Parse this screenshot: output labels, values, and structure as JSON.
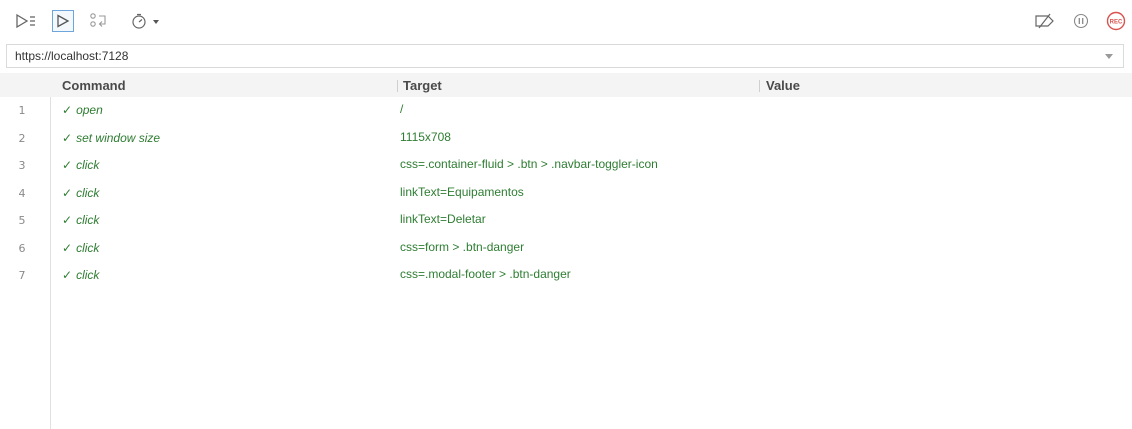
{
  "toolbar": {
    "icons": {
      "run_all": "run-all-tests-icon",
      "run": "run-current-test-icon",
      "step": "step-over-icon",
      "speed": "test-execution-speed-icon",
      "disable_breakpoints": "disable-breakpoints-icon",
      "pause": "pause-on-exceptions-icon",
      "record": "record-icon"
    },
    "record_label": "REC"
  },
  "url_bar": {
    "value": "https://localhost:7128"
  },
  "table": {
    "headers": {
      "command": "Command",
      "target": "Target",
      "value": "Value"
    },
    "rows": [
      {
        "num": "1",
        "command": "open",
        "target": "/",
        "value": ""
      },
      {
        "num": "2",
        "command": "set window size",
        "target": "1115x708",
        "value": ""
      },
      {
        "num": "3",
        "command": "click",
        "target": "css=.container-fluid > .btn > .navbar-toggler-icon",
        "value": ""
      },
      {
        "num": "4",
        "command": "click",
        "target": "linkText=Equipamentos",
        "value": ""
      },
      {
        "num": "5",
        "command": "click",
        "target": "linkText=Deletar",
        "value": ""
      },
      {
        "num": "6",
        "command": "click",
        "target": "css=form > .btn-danger",
        "value": ""
      },
      {
        "num": "7",
        "command": "click",
        "target": "css=.modal-footer > .btn-danger",
        "value": ""
      }
    ],
    "status_symbol": "✓"
  },
  "colors": {
    "success_green": "#2e7d32",
    "record_red": "#d9534f",
    "active_blue": "#6ea6dc"
  }
}
